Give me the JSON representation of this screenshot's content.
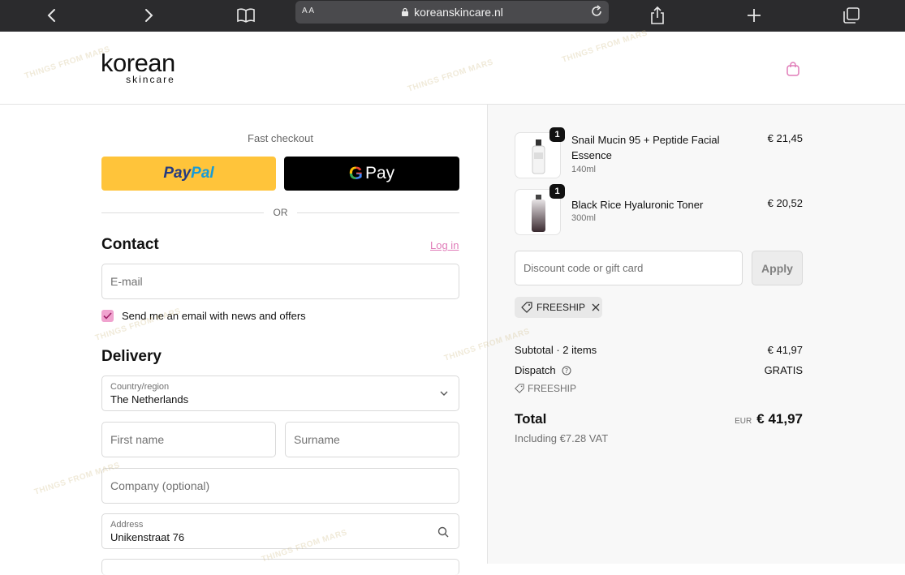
{
  "browser": {
    "url": "koreanskincare.nl",
    "aa_label": "A A"
  },
  "header": {
    "logo_main": "korean",
    "logo_sub": "skincare"
  },
  "checkout": {
    "fast_checkout_label": "Fast checkout",
    "paypal_pay": "Pay",
    "paypal_pal": "Pal",
    "gpay_g": "G",
    "gpay_label": "Pay",
    "or_label": "OR"
  },
  "contact": {
    "title": "Contact",
    "login_link": "Log in",
    "email_placeholder": "E-mail",
    "newsletter_label": "Send me an email with news and offers",
    "newsletter_checked": true
  },
  "delivery": {
    "title": "Delivery",
    "country_label": "Country/region",
    "country_value": "The Netherlands",
    "first_name_placeholder": "First name",
    "surname_placeholder": "Surname",
    "company_placeholder": "Company (optional)",
    "address_label": "Address",
    "address_value": "Unikenstraat 76"
  },
  "order": {
    "items": [
      {
        "name": "Snail Mucin 95 + Peptide Facial Essence",
        "variant": "140ml",
        "price": "€ 21,45",
        "qty": "1"
      },
      {
        "name": "Black Rice Hyaluronic Toner",
        "variant": "300ml",
        "price": "€ 20,52",
        "qty": "1"
      }
    ],
    "discount_placeholder": "Discount code or gift card",
    "apply_label": "Apply",
    "applied_code": "FREESHIP",
    "subtotal_label": "Subtotal · 2 items",
    "subtotal_value": "€ 41,97",
    "dispatch_label": "Dispatch",
    "dispatch_value": "GRATIS",
    "dispatch_code": "FREESHIP",
    "total_label": "Total",
    "total_currency": "EUR",
    "total_value": "€ 41,97",
    "vat_note": "Including €7.28 VAT"
  },
  "watermark_text": "THINGS FROM MARS",
  "colors": {
    "accent_pink": "#e07bb8",
    "checkbox_pink": "#f0a3cf",
    "paypal_yellow": "#ffc43a",
    "browser_bar": "#2b2b2d"
  }
}
